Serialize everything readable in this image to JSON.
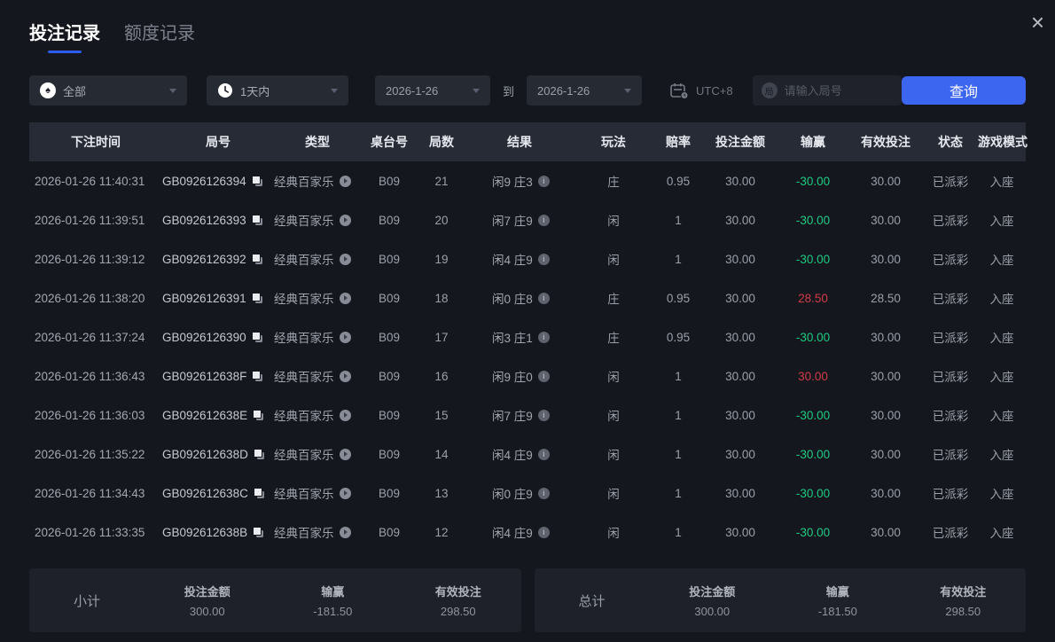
{
  "window": {
    "close_icon": "×"
  },
  "tabs": [
    {
      "label": "投注记录",
      "active": true
    },
    {
      "label": "额度记录",
      "active": false
    }
  ],
  "icons": {
    "spade": "♠",
    "round_badge": "局",
    "info": "i"
  },
  "filters": {
    "game_type": {
      "value": "全部"
    },
    "time_range": {
      "value": "1天内"
    },
    "date_from": "2026-1-26",
    "to_label": "到",
    "date_to": "2026-1-26",
    "timezone": "UTC+8",
    "round_input": {
      "placeholder": "请输入局号",
      "value": ""
    },
    "search_button": "查询"
  },
  "table": {
    "columns": [
      "下注时间",
      "局号",
      "类型",
      "桌台号",
      "局数",
      "结果",
      "玩法",
      "赔率",
      "投注金额",
      "输赢",
      "有效投注",
      "状态",
      "游戏模式"
    ],
    "rows": [
      {
        "time": "2026-01-26 11:40:31",
        "round_id": "GB0926126394",
        "type": "经典百家乐",
        "table_no": "B09",
        "round_no": "21",
        "result": "闲9 庄3",
        "play": "庄",
        "odds": "0.95",
        "bet": "30.00",
        "win": "-30.00",
        "win_color": "green",
        "valid_bet": "30.00",
        "status": "已派彩",
        "mode": "入座"
      },
      {
        "time": "2026-01-26 11:39:51",
        "round_id": "GB0926126393",
        "type": "经典百家乐",
        "table_no": "B09",
        "round_no": "20",
        "result": "闲7 庄9",
        "play": "闲",
        "odds": "1",
        "bet": "30.00",
        "win": "-30.00",
        "win_color": "green",
        "valid_bet": "30.00",
        "status": "已派彩",
        "mode": "入座"
      },
      {
        "time": "2026-01-26 11:39:12",
        "round_id": "GB0926126392",
        "type": "经典百家乐",
        "table_no": "B09",
        "round_no": "19",
        "result": "闲4 庄9",
        "play": "闲",
        "odds": "1",
        "bet": "30.00",
        "win": "-30.00",
        "win_color": "green",
        "valid_bet": "30.00",
        "status": "已派彩",
        "mode": "入座"
      },
      {
        "time": "2026-01-26 11:38:20",
        "round_id": "GB0926126391",
        "type": "经典百家乐",
        "table_no": "B09",
        "round_no": "18",
        "result": "闲0 庄8",
        "play": "庄",
        "odds": "0.95",
        "bet": "30.00",
        "win": "28.50",
        "win_color": "red",
        "valid_bet": "28.50",
        "status": "已派彩",
        "mode": "入座"
      },
      {
        "time": "2026-01-26 11:37:24",
        "round_id": "GB0926126390",
        "type": "经典百家乐",
        "table_no": "B09",
        "round_no": "17",
        "result": "闲3 庄1",
        "play": "庄",
        "odds": "0.95",
        "bet": "30.00",
        "win": "-30.00",
        "win_color": "green",
        "valid_bet": "30.00",
        "status": "已派彩",
        "mode": "入座"
      },
      {
        "time": "2026-01-26 11:36:43",
        "round_id": "GB092612638F",
        "type": "经典百家乐",
        "table_no": "B09",
        "round_no": "16",
        "result": "闲9 庄0",
        "play": "闲",
        "odds": "1",
        "bet": "30.00",
        "win": "30.00",
        "win_color": "red",
        "valid_bet": "30.00",
        "status": "已派彩",
        "mode": "入座"
      },
      {
        "time": "2026-01-26 11:36:03",
        "round_id": "GB092612638E",
        "type": "经典百家乐",
        "table_no": "B09",
        "round_no": "15",
        "result": "闲7 庄9",
        "play": "闲",
        "odds": "1",
        "bet": "30.00",
        "win": "-30.00",
        "win_color": "green",
        "valid_bet": "30.00",
        "status": "已派彩",
        "mode": "入座"
      },
      {
        "time": "2026-01-26 11:35:22",
        "round_id": "GB092612638D",
        "type": "经典百家乐",
        "table_no": "B09",
        "round_no": "14",
        "result": "闲4 庄9",
        "play": "闲",
        "odds": "1",
        "bet": "30.00",
        "win": "-30.00",
        "win_color": "green",
        "valid_bet": "30.00",
        "status": "已派彩",
        "mode": "入座"
      },
      {
        "time": "2026-01-26 11:34:43",
        "round_id": "GB092612638C",
        "type": "经典百家乐",
        "table_no": "B09",
        "round_no": "13",
        "result": "闲0 庄9",
        "play": "闲",
        "odds": "1",
        "bet": "30.00",
        "win": "-30.00",
        "win_color": "green",
        "valid_bet": "30.00",
        "status": "已派彩",
        "mode": "入座"
      },
      {
        "time": "2026-01-26 11:33:35",
        "round_id": "GB092612638B",
        "type": "经典百家乐",
        "table_no": "B09",
        "round_no": "12",
        "result": "闲4 庄9",
        "play": "闲",
        "odds": "1",
        "bet": "30.00",
        "win": "-30.00",
        "win_color": "green",
        "valid_bet": "30.00",
        "status": "已派彩",
        "mode": "入座"
      }
    ]
  },
  "summary": {
    "subtotal": {
      "label": "小计",
      "bet_label": "投注金额",
      "bet": "300.00",
      "win_label": "输赢",
      "win": "-181.50",
      "win_color": "green",
      "valid_label": "有效投注",
      "valid": "298.50"
    },
    "total": {
      "label": "总计",
      "bet_label": "投注金额",
      "bet": "300.00",
      "win_label": "输赢",
      "win": "-181.50",
      "win_color": "green",
      "valid_label": "有效投注",
      "valid": "298.50"
    }
  },
  "colors": {
    "background": "#15171e",
    "table_header_bg": "#272b36",
    "panel_bg": "#1e212a",
    "accent_blue": "#3d66f0",
    "tab_underline": "#2e5bf0",
    "win_red": "#d03c46",
    "loss_green": "#1ecb81"
  }
}
